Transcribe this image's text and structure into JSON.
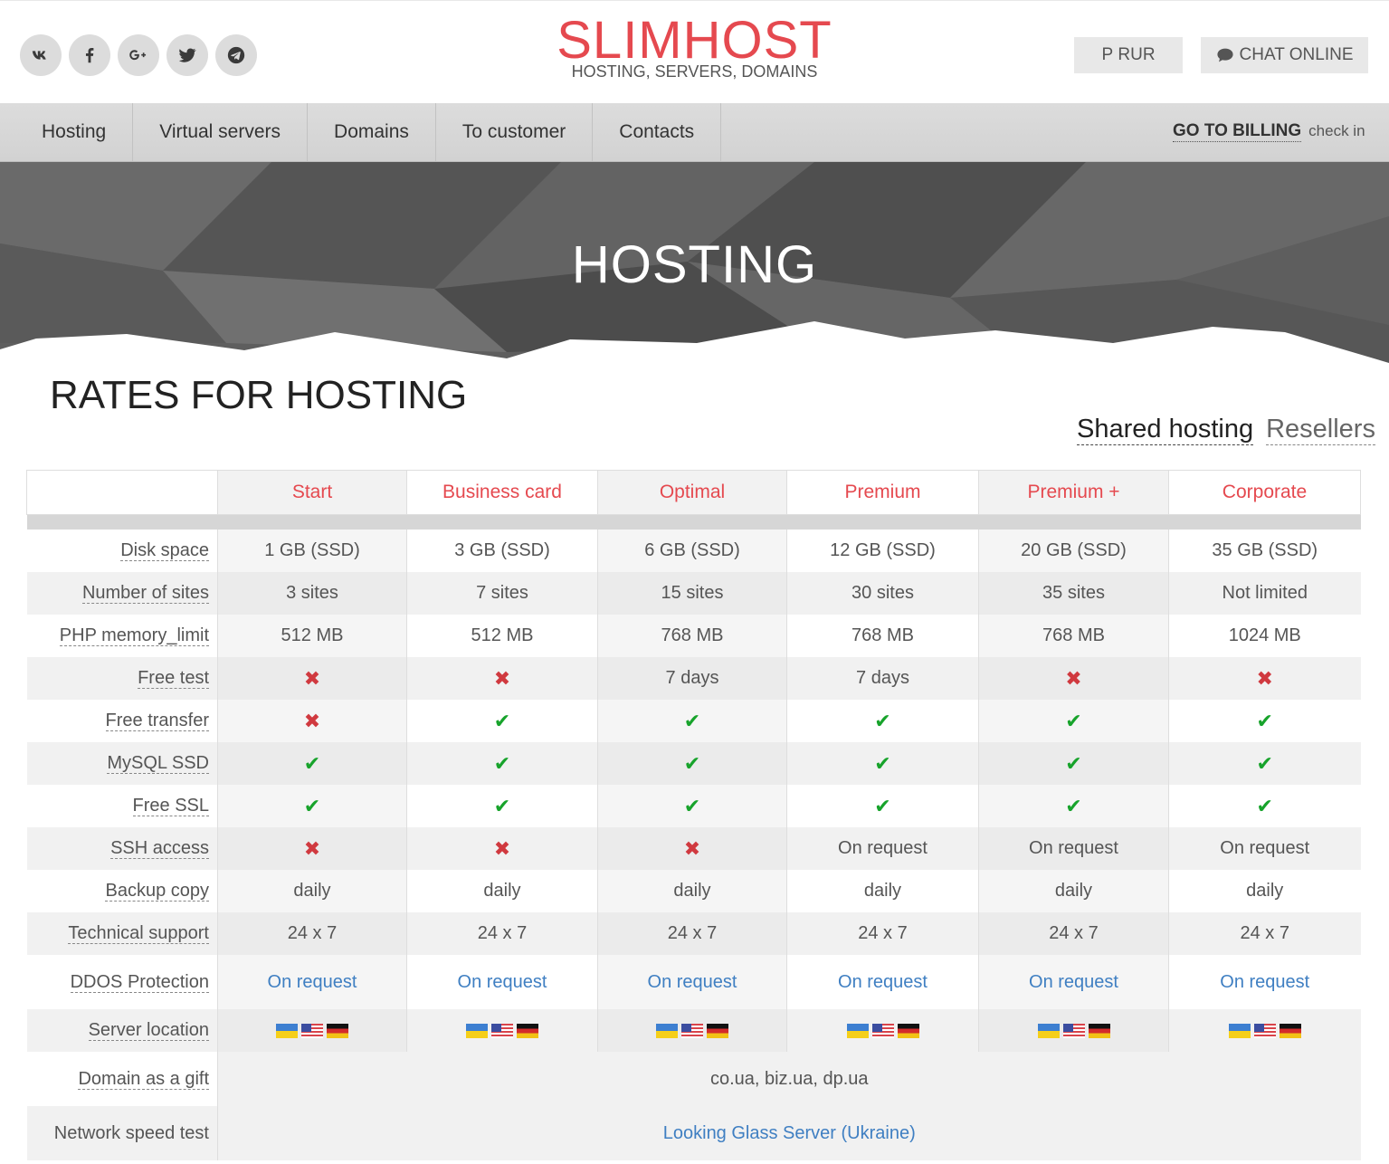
{
  "header": {
    "logo_title": "SLIMHOST",
    "logo_subtitle": "HOSTING, SERVERS, DOMAINS",
    "currency_label": "Р RUR",
    "chat_label": "CHAT ONLINE",
    "social": [
      "vk-icon",
      "facebook-icon",
      "google-plus-icon",
      "twitter-icon",
      "telegram-icon"
    ]
  },
  "nav": {
    "items": [
      "Hosting",
      "Virtual servers",
      "Domains",
      "To customer",
      "Contacts"
    ],
    "billing_label": "GO TO BILLING",
    "checkin_label": "check in"
  },
  "hero": {
    "title": "HOSTING"
  },
  "rates": {
    "title": "RATES FOR HOSTING",
    "tabs": [
      "Shared hosting",
      "Resellers"
    ],
    "plans": [
      "Start",
      "Business card",
      "Optimal",
      "Premium",
      "Premium +",
      "Corporate"
    ],
    "rows": [
      {
        "label": "Disk space",
        "values": [
          "1 GB (SSD)",
          "3 GB (SSD)",
          "6 GB (SSD)",
          "12 GB (SSD)",
          "20 GB (SSD)",
          "35 GB (SSD)"
        ]
      },
      {
        "label": "Number of sites",
        "values": [
          "3 sites",
          "7 sites",
          "15 sites",
          "30 sites",
          "35 sites",
          "Not limited"
        ]
      },
      {
        "label": "PHP memory_limit",
        "values": [
          "512 MB",
          "512 MB",
          "768 MB",
          "768 MB",
          "768 MB",
          "1024 MB"
        ]
      },
      {
        "label": "Free test",
        "values": [
          "no",
          "no",
          "7 days",
          "7 days",
          "no",
          "no"
        ]
      },
      {
        "label": "Free transfer",
        "values": [
          "no",
          "yes",
          "yes",
          "yes",
          "yes",
          "yes"
        ]
      },
      {
        "label": "MySQL SSD",
        "values": [
          "yes",
          "yes",
          "yes",
          "yes",
          "yes",
          "yes"
        ]
      },
      {
        "label": "Free SSL",
        "values": [
          "yes",
          "yes",
          "yes",
          "yes",
          "yes",
          "yes"
        ]
      },
      {
        "label": "SSH access",
        "values": [
          "no",
          "no",
          "no",
          "On request",
          "On request",
          "On request"
        ]
      },
      {
        "label": "Backup copy",
        "values": [
          "daily",
          "daily",
          "daily",
          "daily",
          "daily",
          "daily"
        ]
      },
      {
        "label": "Technical support",
        "values": [
          "24 x 7",
          "24 x 7",
          "24 x 7",
          "24 x 7",
          "24 x 7",
          "24 x 7"
        ]
      },
      {
        "label": "DDOS Protection",
        "values": [
          "On request",
          "On request",
          "On request",
          "On request",
          "On request",
          "On request"
        ],
        "link": true
      }
    ],
    "server_location_label": "Server location",
    "server_flags": [
      "ua-flag-icon",
      "us-flag-icon",
      "de-flag-icon"
    ],
    "domain_gift_label": "Domain as a gift",
    "domain_gift_value": "co.ua, biz.ua, dp.ua",
    "speed_test_label": "Network speed test",
    "speed_test_value": "Looking Glass Server (Ukraine)"
  },
  "colors": {
    "brand": "#e5494f",
    "link": "#3f7fc2",
    "yes": "#17a32b",
    "no": "#d0393f"
  }
}
